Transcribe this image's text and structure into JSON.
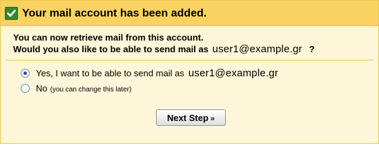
{
  "title_bar": {
    "icon": "checkmark-icon",
    "title": "Your mail account has been added."
  },
  "intro": {
    "line1": "You can now retrieve mail from this account.",
    "line2_prefix": "Would you also like to be able to send mail as",
    "email": "user1@example.gr",
    "line2_suffix": "?"
  },
  "options": {
    "yes": {
      "label": "Yes, I want to be able to send mail as",
      "email": "user1@example.gr",
      "selected": true
    },
    "no": {
      "label": "No",
      "hint": "(you can change this later)",
      "selected": false
    }
  },
  "buttons": {
    "next_label": "Next Step",
    "next_arrow": "»"
  },
  "colors": {
    "title_bar_bg": "#fad163",
    "panel_bg": "#fef6d8",
    "border": "#e8c84c",
    "check_green": "#2f8a2f"
  }
}
